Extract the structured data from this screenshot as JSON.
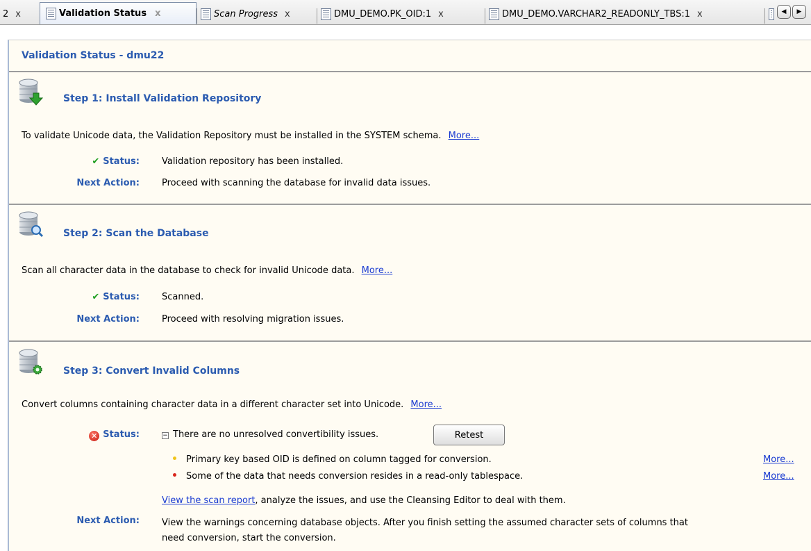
{
  "tabs": [
    {
      "label": "2",
      "close": "x"
    },
    {
      "label": "Validation Status",
      "close": "x"
    },
    {
      "label": "Scan Progress",
      "close": "x"
    },
    {
      "label": "DMU_DEMO.PK_OID:1",
      "close": "x"
    },
    {
      "label": "DMU_DEMO.VARCHAR2_READONLY_TBS:1",
      "close": "x"
    }
  ],
  "page_title": "Validation Status - dmu22",
  "labels": {
    "status": "Status:",
    "next_action": "Next Action:",
    "more": "More..."
  },
  "steps": [
    {
      "title": "Step 1: Install Validation Repository",
      "description": "To validate Unicode data, the Validation Repository must be installed in the SYSTEM schema.",
      "status_icon": "check-icon",
      "status": "Validation repository has been installed.",
      "next_action": "Proceed with scanning the database for invalid data issues."
    },
    {
      "title": "Step 2: Scan the Database",
      "description": "Scan all character data in the database to check for invalid Unicode data.",
      "status_icon": "check-icon",
      "status": "Scanned.",
      "next_action": "Proceed with resolving migration issues."
    },
    {
      "title": "Step 3: Convert Invalid Columns",
      "description": "Convert columns containing character data in a different character set into Unicode.",
      "status_icon": "error-icon",
      "status": "There are no unresolved convertibility issues.",
      "retest_label": "Retest",
      "issues": [
        {
          "text": "Primary key based OID is defined on column tagged for conversion.",
          "color": "#f0c419"
        },
        {
          "text": "Some of the data that needs conversion resides in a read-only tablespace.",
          "color": "#d9261c"
        }
      ],
      "scan_report_link": "View the scan report",
      "scan_report_rest": ", analyze the issues, and use the Cleansing Editor to deal with them.",
      "next_action_line1": "View the warnings concerning database objects. After you finish setting the assumed character sets of columns that",
      "next_action_line2": "need conversion, start the conversion."
    }
  ]
}
